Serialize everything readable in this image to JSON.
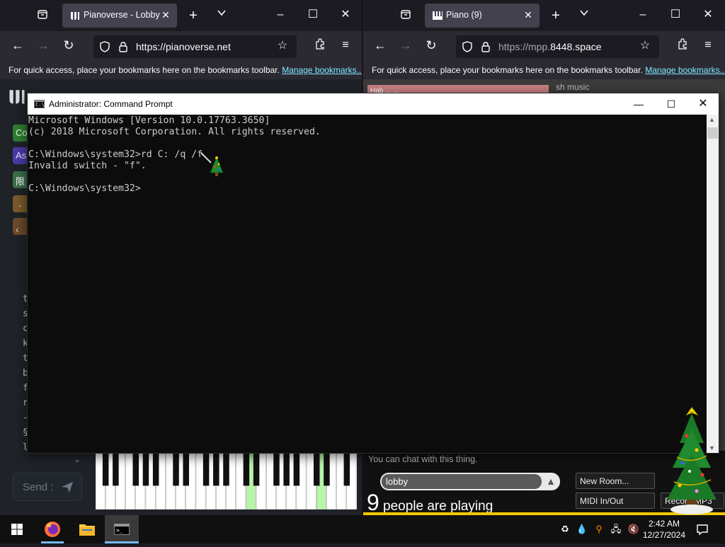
{
  "left_window": {
    "tab_title": "Pianoverse - Lobby",
    "url": "https://pianoverse.net",
    "bookmark_hint": "For quick access, place your bookmarks here on the bookmarks toolbar.",
    "bookmark_link": "Manage bookmarks...",
    "page": {
      "sidebar_badges": [
        "Co",
        "As",
        "限",
        ".",
        ""
      ],
      "chat_letters": [
        "t",
        "s",
        "c",
        "k",
        "t",
        "b",
        "f",
        "r",
        "-",
        "§",
        "l"
      ],
      "send_label": "Send :"
    }
  },
  "right_window": {
    "tab_title": "Piano (9)",
    "url_prefix": "https://mpp.",
    "url_domain": "8448.space",
    "bookmark_hint": "For quick access, place your bookmarks here on the bookmarks toolbar.",
    "bookmark_link": "Manage bookmarks...",
    "page": {
      "chat_hint": "You can chat with this thing.",
      "room_name": "lobby",
      "player_count": "9",
      "players_label": "people are playing",
      "new_room_label": "New Room...",
      "midi_label": "MIDI In/Out",
      "record_label": "Record MP3",
      "top_banner": "Hab ... ...",
      "top_right_text": "sh music"
    }
  },
  "cmd": {
    "title": "Administrator: Command Prompt",
    "lines": [
      "Microsoft Windows [Version 10.0.17763.3650]",
      "(c) 2018 Microsoft Corporation. All rights reserved.",
      "",
      "C:\\Windows\\system32>rd C: /q /f",
      "Invalid switch - \"f\".",
      "",
      "C:\\Windows\\system32>"
    ]
  },
  "taskbar": {
    "time": "2:42 AM",
    "date": "12/27/2024"
  },
  "colors": {
    "firefox_dark": "#1c1b22",
    "toolbar": "#2b2a33",
    "link": "#80ebff",
    "cmd_bg": "#0c0c0c",
    "cmd_text": "#cccccc",
    "taskbar": "#101010"
  }
}
